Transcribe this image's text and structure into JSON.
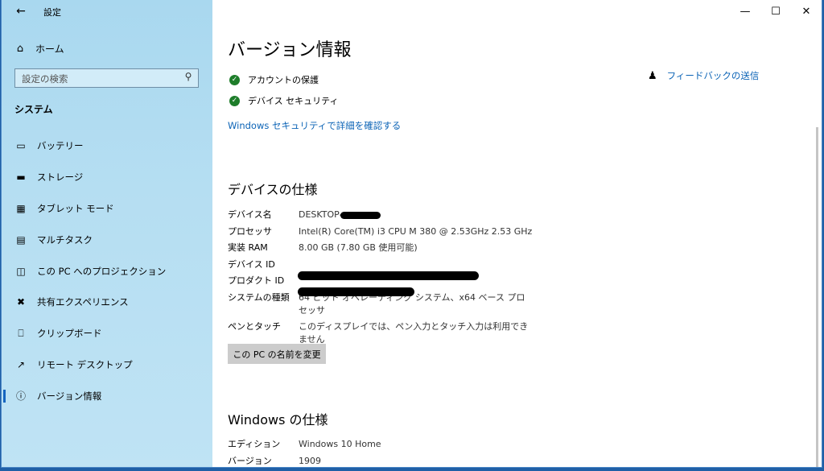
{
  "app": {
    "title": "設定"
  },
  "sidebar": {
    "home_label": "ホーム",
    "search_placeholder": "設定の検索",
    "section": "システム",
    "items": [
      {
        "label": "バッテリー",
        "icon": "battery-icon"
      },
      {
        "label": "ストレージ",
        "icon": "storage-icon"
      },
      {
        "label": "タブレット モード",
        "icon": "tablet-mode-icon"
      },
      {
        "label": "マルチタスク",
        "icon": "multitasking-icon"
      },
      {
        "label": "この PC へのプロジェクション",
        "icon": "projection-icon"
      },
      {
        "label": "共有エクスペリエンス",
        "icon": "shared-experience-icon"
      },
      {
        "label": "クリップボード",
        "icon": "clipboard-icon"
      },
      {
        "label": "リモート デスクトップ",
        "icon": "remote-desktop-icon"
      },
      {
        "label": "バージョン情報",
        "icon": "info-icon",
        "active": true
      }
    ]
  },
  "main": {
    "title": "バージョン情報",
    "feedback_label": "フィードバックの送信",
    "security_items": [
      "アカウントの保護",
      "デバイス セキュリティ"
    ],
    "security_link": "Windows セキュリティで詳細を確認する",
    "device_spec": {
      "heading": "デバイスの仕様",
      "rows": [
        {
          "key": "デバイス名",
          "value": "DESKTOP-"
        },
        {
          "key": "プロセッサ",
          "value": "Intel(R) Core(TM) i3 CPU       M 380  @ 2.53GHz   2.53 GHz"
        },
        {
          "key": "実装 RAM",
          "value": "8.00 GB (7.80 GB 使用可能)"
        },
        {
          "key": "デバイス ID",
          "value": ""
        },
        {
          "key": "プロダクト ID",
          "value": ""
        },
        {
          "key": "システムの種類",
          "value": "64 ビット オペレーティング システム、x64 ベース プロセッサ"
        },
        {
          "key": "ペンとタッチ",
          "value": "このディスプレイでは、ペン入力とタッチ入力は利用できません"
        }
      ],
      "rename_button": "この PC の名前を変更"
    },
    "windows_spec": {
      "heading": "Windows の仕様",
      "rows": [
        {
          "key": "エディション",
          "value": "Windows 10 Home"
        },
        {
          "key": "バージョン",
          "value": "1909"
        }
      ]
    }
  },
  "colors": {
    "accent": "#0b63b6",
    "sidebar_bg": "#b5def2",
    "ok_green": "#1e7d2a"
  }
}
